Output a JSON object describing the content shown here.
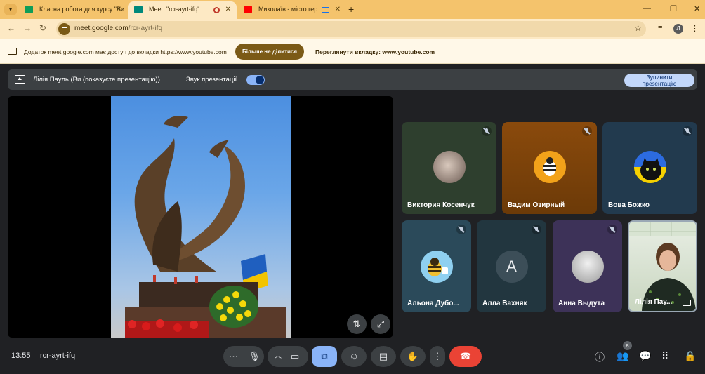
{
  "browser": {
    "tabs": [
      {
        "title": "Класна робота для курсу \"Ви",
        "favicon_color": "#0f9d58"
      },
      {
        "title": "Meet: \"rcr-ayrt-ifq\"",
        "favicon_color": "#00897b"
      },
      {
        "title": "Миколаїв - місто героїв!!!",
        "favicon_color": "#ff0000"
      }
    ],
    "new_tab_label": "+",
    "url_host": "meet.google.com",
    "url_path": "/rcr-ayrt-ifq",
    "profile_initial": "Л"
  },
  "infobar": {
    "message": "Додаток meet.google.com має доступ до вкладки https://www.youtube.com",
    "stop_sharing_label": "Більше не ділитися",
    "view_tab_label": "Переглянути вкладку: www.youtube.com"
  },
  "presenting": {
    "label": "Лілія Пауль (Ви (показуєте презентацію))",
    "sound_label": "Звук презентації",
    "sound_on": true,
    "stop_label_line1": "Зупинити",
    "stop_label_line2": "презентацію"
  },
  "participants": [
    {
      "name": "Виктория Косенчук",
      "bg": "#2e3f2e"
    },
    {
      "name": "Вадим Озирный",
      "bg": "#8a4a0c"
    },
    {
      "name": "Вова Божко",
      "bg": "#223a4e"
    },
    {
      "name": "Альона Дубо...",
      "bg": "#2b4a5a"
    },
    {
      "name": "Алла Вахняк",
      "bg": "#22363f",
      "initial": "A"
    },
    {
      "name": "Анна Выдута",
      "bg": "#3d3258"
    },
    {
      "name": "Лілія Пау...",
      "bg": "#c9d6c0"
    }
  ],
  "bottom": {
    "time": "13:55",
    "meeting_code": "rcr-ayrt-ifq",
    "participant_count": "8"
  },
  "colors": {
    "accent": "#8ab4f8",
    "end_call": "#ea4335",
    "chrome_theme": "#f4c36c"
  }
}
